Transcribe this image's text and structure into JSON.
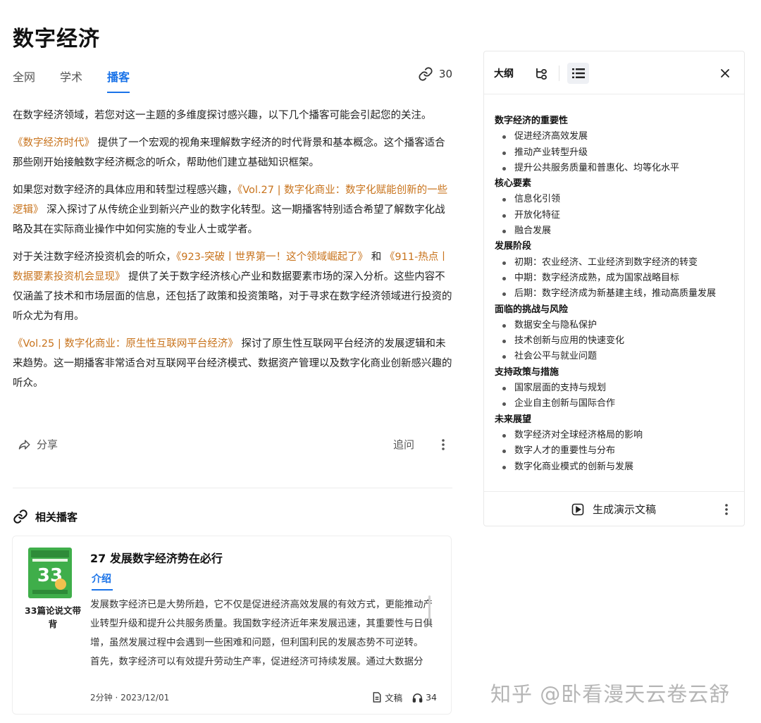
{
  "title": "数字经济",
  "tabs": [
    {
      "label": "全网"
    },
    {
      "label": "学术"
    },
    {
      "label": "播客"
    }
  ],
  "link_count": "30",
  "article": {
    "p1": "在数字经济领域，若您对这一主题的多维度探讨感兴趣，以下几个播客可能会引起您的关注。",
    "p2_link": "《数字经济时代》",
    "p2_text": "提供了一个宏观的视角来理解数字经济的时代背景和基本概念。这个播客适合那些刚开始接触数字经济概念的听众，帮助他们建立基础知识框架。",
    "p3_pre": "如果您对数字经济的具体应用和转型过程感兴趣，",
    "p3_link": "《Vol.27 | 数字化商业：数字化赋能创新的一些逻辑》",
    "p3_text": "深入探讨了从传统企业到新兴产业的数字化转型。这一期播客特别适合希望了解数字化战略及其在实际商业操作中如何实施的专业人士或学者。",
    "p4_pre": "对于关注数字经济投资机会的听众，",
    "p4_link1": "《923-突破丨世界第一！这个领域崛起了》",
    "p4_mid": "和",
    "p4_link2": "《911-热点丨数据要素投资机会显现》",
    "p4_text": "提供了关于数字经济核心产业和数据要素市场的深入分析。这些内容不仅涵盖了技术和市场层面的信息，还包括了政策和投资策略，对于寻求在数字经济领域进行投资的听众尤为有用。",
    "p5_link": "《Vol.25 | 数字化商业：原生性互联网平台经济》",
    "p5_text": "探讨了原生性互联网平台经济的发展逻辑和未来趋势。这一期播客非常适合对互联网平台经济模式、数据资产管理以及数字化商业创新感兴趣的听众。"
  },
  "actions": {
    "share": "分享",
    "followup": "追问"
  },
  "related": {
    "heading": "相关播客",
    "card": {
      "cover_name": "33篇论说文带背",
      "title": "27 发展数字经济势在必行",
      "tab": "介绍",
      "desc1": "发展数字经济已是大势所趋，它不仅是促进经济高效发展的有效方式，更能推动产业转型升级和提升公共服务质量。我国数字经济近年来发展迅速，其重要性与日俱增，虽然发展过程中会遇到一些困难和问题，但利国利民的发展态势不可逆转。",
      "desc2": "首先，数字经济可以有效提升劳动生产率，促进经济可持续发展。通过大数据分",
      "meta": "2分钟 · 2023/12/01",
      "doc_label": "文稿",
      "listens": "34"
    }
  },
  "outline": {
    "title": "大纲",
    "sections": [
      {
        "heading": "数字经济的重要性",
        "items": [
          "促进经济高效发展",
          "推动产业转型升级",
          "提升公共服务质量和普惠化、均等化水平"
        ]
      },
      {
        "heading": "核心要素",
        "items": [
          "信息化引领",
          "开放化特征",
          "融合发展"
        ]
      },
      {
        "heading": "发展阶段",
        "items": [
          "初期：农业经济、工业经济到数字经济的转变",
          "中期：数字经济成熟，成为国家战略目标",
          "后期：数字经济成为新基建主线，推动高质量发展"
        ]
      },
      {
        "heading": "面临的挑战与风险",
        "items": [
          "数据安全与隐私保护",
          "技术创新与应用的快速变化",
          "社会公平与就业问题"
        ]
      },
      {
        "heading": "支持政策与措施",
        "items": [
          "国家层面的支持与规划",
          "企业自主创新与国际合作"
        ]
      },
      {
        "heading": "未来展望",
        "items": [
          "数字经济对全球经济格局的影响",
          "数字人才的重要性与分布",
          "数字化商业模式的创新与发展"
        ]
      }
    ],
    "generate_label": "生成演示文稿"
  },
  "watermark": "知乎 @卧看漫天云卷云舒",
  "colors": {
    "accent": "#1a73e8",
    "link": "#c8731c"
  }
}
